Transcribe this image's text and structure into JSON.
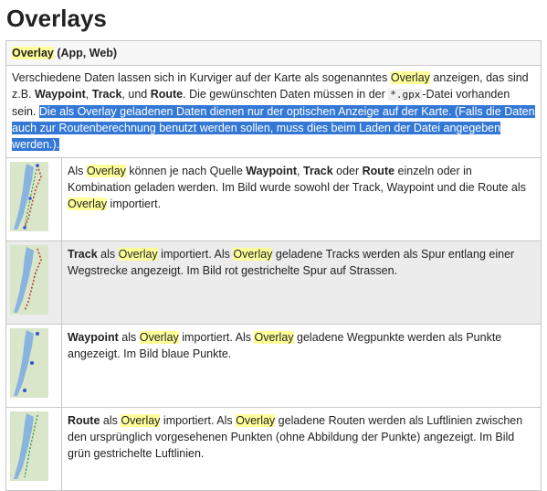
{
  "page": {
    "title": "Overlays"
  },
  "header": {
    "label": "Overlay",
    "suffix": " (App, Web)"
  },
  "intro": {
    "t1": "Verschiedene Daten lassen sich in Kurviger auf der Karte als sogenanntes ",
    "hl1": "Overlay",
    "t2": " anzeigen, das sind z.B. ",
    "b1": "Waypoint",
    "t3": ", ",
    "b2": "Track",
    "t4": ", und ",
    "b3": "Route",
    "t5": ". Die gewünschten Daten müssen in der ",
    "code1": "*",
    "code2": ".gpx",
    "t6": "-Datei vorhanden sein. ",
    "selected": "Die als Overlay geladenen Daten dienen nur der optischen Anzeige auf der Karte. (Falls die Daten auch zur Routenberechnung benutzt werden sollen, muss dies beim Laden der Datei angegeben werden.)."
  },
  "rows": [
    {
      "p1": "Als ",
      "hl1": "Overlay",
      "p2": " können je nach Quelle ",
      "b1": "Waypoint",
      "p3": ", ",
      "b2": "Track",
      "p4": " oder ",
      "b3": "Route",
      "p5": " einzeln oder in Kombination geladen werden. Im Bild wurde sowohl der Track, Waypoint und die Route als ",
      "hl2": "Overlay",
      "p6": " importiert."
    },
    {
      "b1": "Track",
      "p1": " als ",
      "hl1": "Overlay",
      "p2": " importiert. Als ",
      "hl2": "Overlay",
      "p3": " geladene Tracks werden als Spur entlang einer Wegstrecke angezeigt. Im Bild rot gestrichelte Spur auf Strassen."
    },
    {
      "b1": "Waypoint",
      "p1": " als ",
      "hl1": "Overlay",
      "p2": " importiert. Als ",
      "hl2": "Overlay",
      "p3": " geladene Wegpunkte werden als Punkte angezeigt. Im Bild blaue Punkte."
    },
    {
      "b1": "Route",
      "p1": " als ",
      "hl1": "Overlay",
      "p2": " importiert. Als ",
      "hl2": "Overlay",
      "p3": " geladene Routen werden als Luftlinien zwischen den ursprünglich vorgesehenen Punkten (ohne Abbildung der Punkte) angezeigt. Im Bild grün gestrichelte Luftlinien."
    }
  ],
  "colors": {
    "highlight": "#ffff99",
    "selection": "#3478d6",
    "row_gray": "#ececec",
    "map_lake": "#8ab4e0",
    "map_land": "#d9e6c9"
  }
}
